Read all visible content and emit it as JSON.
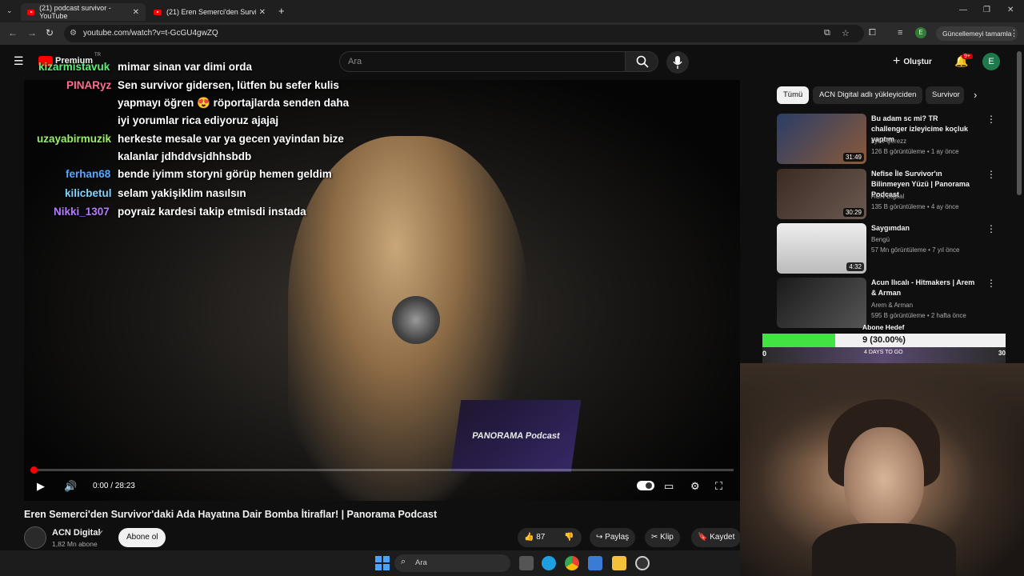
{
  "browser": {
    "tabs": [
      {
        "label": "(21) podcast survivor - YouTube"
      },
      {
        "label": "(21) Eren Semerci'den Survivor'..."
      }
    ],
    "new_tab": "+",
    "url": "youtube.com/watch?v=t-GcGU4gwZQ",
    "update_button": "Güncellemeyi tamamla",
    "profile_initial": "E"
  },
  "youtube": {
    "logo_text": "Premium",
    "logo_region": "TR",
    "search_placeholder": "Ara",
    "create_label": "Oluştur",
    "notif_badge": "9+",
    "avatar_initial": "E"
  },
  "chat": [
    {
      "user": "kizarmistavuk",
      "user_color": "#5cf07a",
      "lines": [
        "mimar sinan var dimi orda"
      ]
    },
    {
      "user": "PINARyz",
      "user_color": "#ff6f91",
      "lines": [
        "Sen survivor gidersen, lütfen bu sefer kulis",
        "yapmayı öğren 😍 röportajlarda senden daha",
        "iyi yorumlar rica ediyoruz ajajaj"
      ]
    },
    {
      "user": "uzayabirmuzik",
      "user_color": "#9bf06a",
      "lines": [
        "herkeste mesale var ya gecen yayindan bize",
        "kalanlar jdhddvsjdhhsbdb"
      ]
    },
    {
      "user": "ferhan68",
      "user_color": "#5aa8ff",
      "lines": [
        "bende iyimm storyni görüp hemen geldim"
      ]
    },
    {
      "user": "kilicbetul",
      "user_color": "#7fd3ff",
      "lines": [
        "selam yakişiklim nasılsın"
      ]
    },
    {
      "user": "Nikki_1307",
      "user_color": "#b57bff",
      "lines": [
        "poyraiz kardesi takip etmisdi instada"
      ]
    }
  ],
  "video": {
    "time": "0:00 / 28:23",
    "progress": 0.0,
    "logo_panel_text": "PANORAMA Podcast"
  },
  "below_video": {
    "title": "Eren Semerci'den Survivor'daki Ada Hayatına Dair Bomba İtiraflar! | Panorama Podcast",
    "channel": "ACN Digital",
    "subscribers": "1,82 Mn abone",
    "subscribe": "Abone ol",
    "likes": "87",
    "share": "Paylaş",
    "clip": "Klip",
    "save": "Kaydet"
  },
  "sidebar": {
    "chips": [
      "Tümü",
      "ACN Digital adlı yükleyiciden",
      "Survivor"
    ],
    "recommendations": [
      {
        "title": "Bu adam sc mi? TR challenger izleyicime koçluk yaptım",
        "channel": "Lynx Çerezz",
        "meta": "126 B görüntüleme • 1 ay önce",
        "duration": "31:49",
        "thumb_color": "#3a4a6a"
      },
      {
        "title": "Nefise İle Survivor'ın Bilinmeyen Yüzü | Panorama Podcast",
        "channel": "ACN Digital",
        "meta": "135 B görüntüleme • 4 ay önce",
        "duration": "30:29",
        "thumb_color": "#4a3a30"
      },
      {
        "title": "Saygımdan",
        "channel": "Bengü",
        "meta": "57 Mn görüntüleme • 7 yıl önce",
        "duration": "4:32",
        "thumb_color": "#d8d8d8"
      },
      {
        "title": "Acun Ilıcalı - Hitmakers | Arem & Arman",
        "channel": "Arem & Arman",
        "meta": "595 B görüntüleme • 2 hafta önce",
        "duration": "",
        "thumb_color": "#2a2a2a"
      }
    ]
  },
  "goal": {
    "label": "Abone Hedef",
    "text": "9 (30.00%)",
    "fraction": 0.3,
    "min": "0",
    "max": "30",
    "days": "4 DAYS TO GO",
    "fill_color": "#42e243"
  },
  "taskbar": {
    "search_label": "Ara"
  }
}
